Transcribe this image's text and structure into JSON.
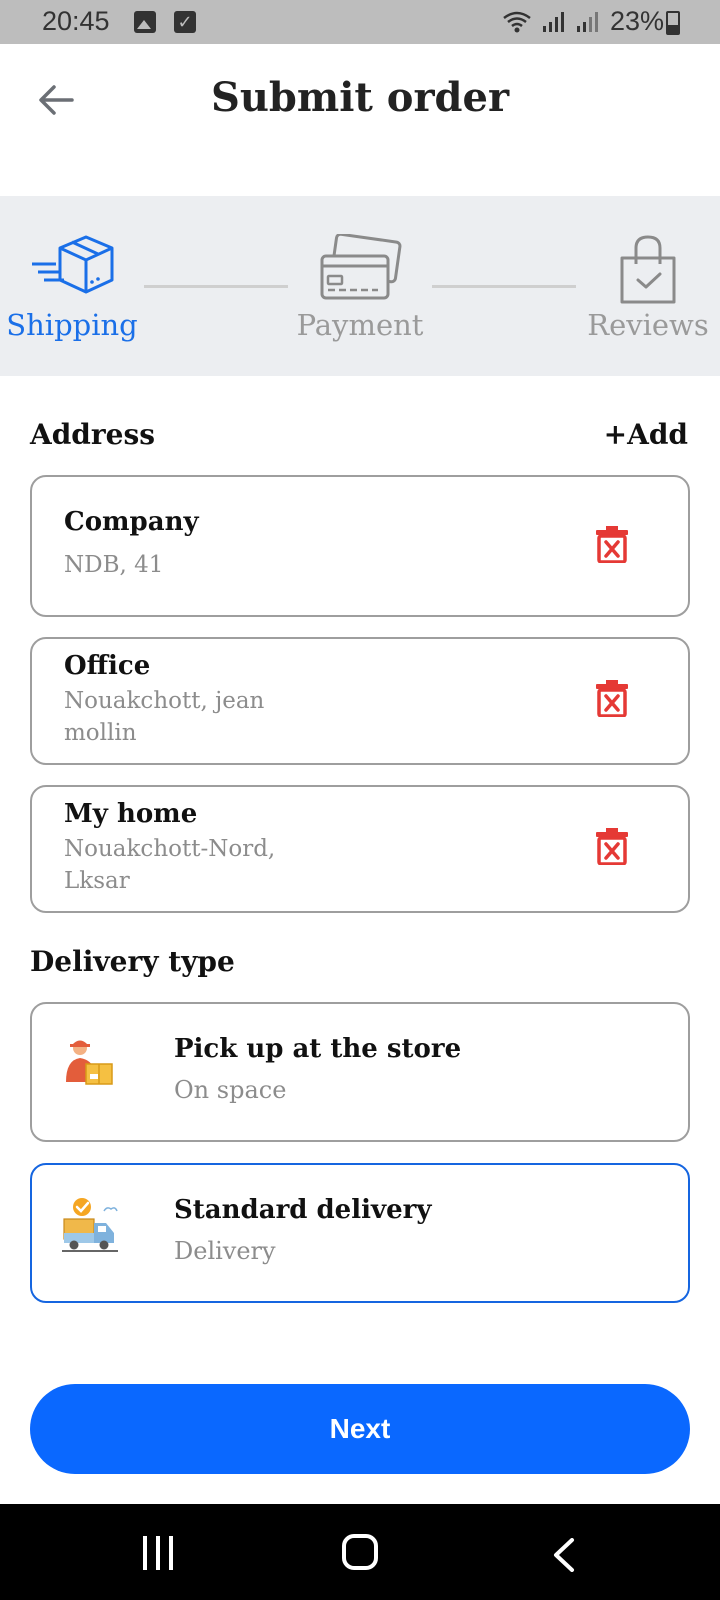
{
  "status_bar": {
    "time": "20:45",
    "battery": "23%"
  },
  "header": {
    "title": "Submit order"
  },
  "steps": [
    {
      "label": "Shipping",
      "active": true
    },
    {
      "label": "Payment",
      "active": false
    },
    {
      "label": "Reviews",
      "active": false
    }
  ],
  "address_section": {
    "title": "Address",
    "add_label": "+Add"
  },
  "addresses": [
    {
      "name": "Company",
      "line1": "NDB, 41",
      "line2": ""
    },
    {
      "name": "Office",
      "line1": "Nouakchott, jean",
      "line2": "mollin"
    },
    {
      "name": "My home",
      "line1": "Nouakchott-Nord,",
      "line2": "Lksar"
    }
  ],
  "delivery_section": {
    "title": "Delivery type"
  },
  "delivery_options": [
    {
      "title": "Pick up at the store",
      "subtitle": "On space",
      "selected": false
    },
    {
      "title": "Standard delivery",
      "subtitle": "Delivery",
      "selected": true
    }
  ],
  "next_button": {
    "label": "Next"
  },
  "colors": {
    "accent": "#0a68ff",
    "active_step": "#1a6fe8",
    "inactive_step": "#9a9a9a",
    "delete": "#e53935"
  }
}
